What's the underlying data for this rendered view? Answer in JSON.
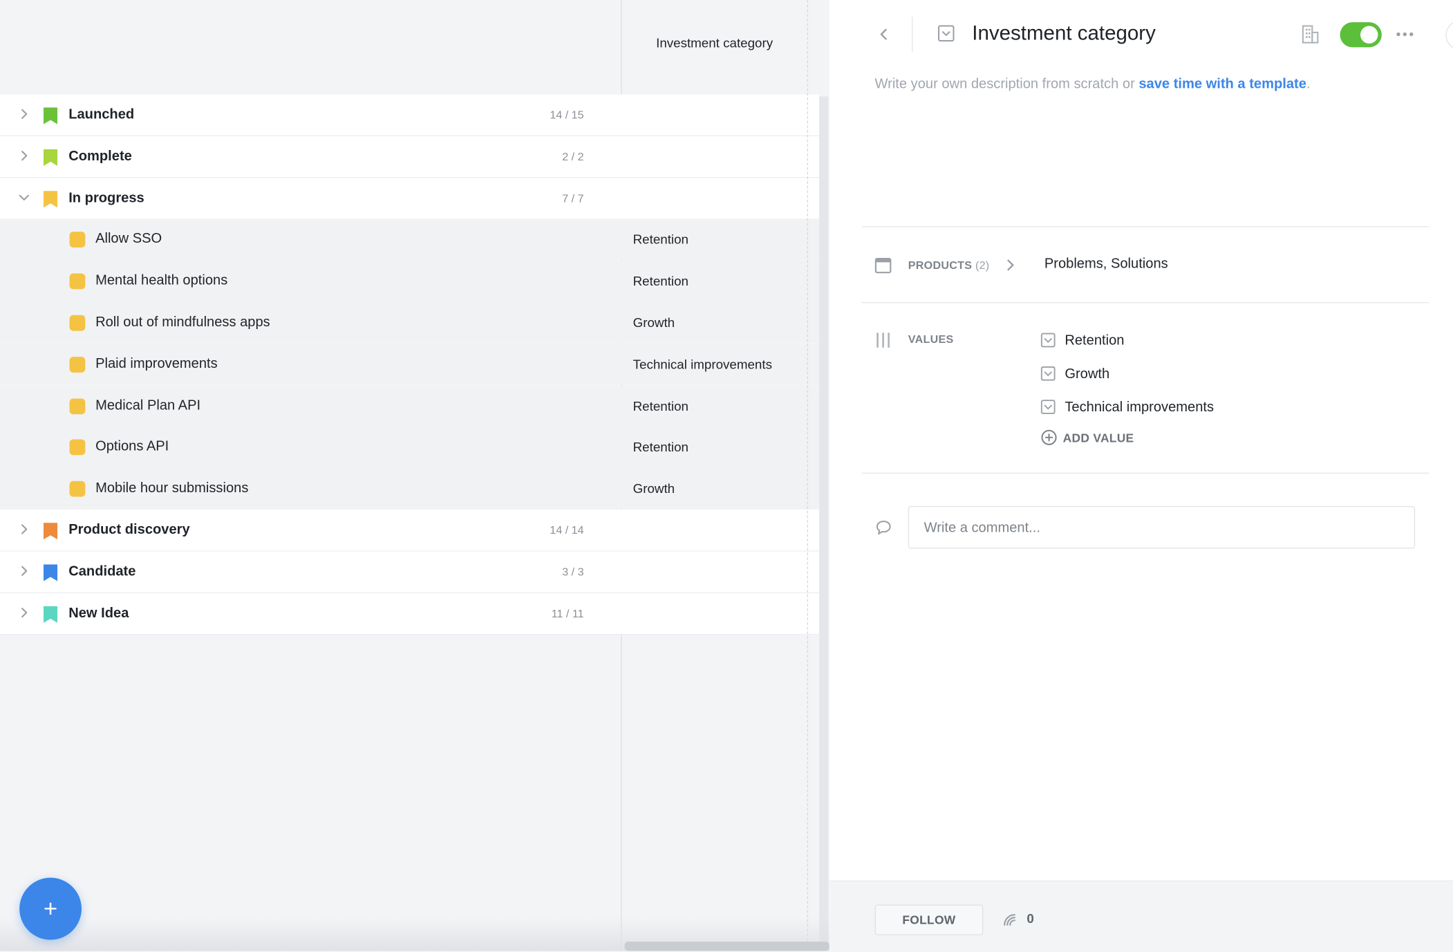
{
  "table": {
    "column_header": "Investment category",
    "rows": [
      {
        "label": "Launched",
        "count": "14 / 15",
        "color": "#6cc13b"
      },
      {
        "label": "Complete",
        "count": "2 / 2",
        "color": "#a8d63c"
      },
      {
        "label": "In progress",
        "count": "7 / 7",
        "color": "#f5c343",
        "expanded": true,
        "children": [
          {
            "label": "Allow SSO",
            "category": "Retention"
          },
          {
            "label": "Mental health options",
            "category": "Retention"
          },
          {
            "label": "Roll out of mindfulness apps",
            "category": "Growth"
          },
          {
            "label": "Plaid improvements",
            "category": "Technical improvements"
          },
          {
            "label": "Medical Plan API",
            "category": "Retention"
          },
          {
            "label": "Options API",
            "category": "Retention"
          },
          {
            "label": "Mobile hour submissions",
            "category": "Growth"
          }
        ]
      },
      {
        "label": "Product discovery",
        "count": "14 / 14",
        "color": "#ee8a3c"
      },
      {
        "label": "Candidate",
        "count": "3 / 3",
        "color": "#3b86e8"
      },
      {
        "label": "New Idea",
        "count": "11 / 11",
        "color": "#5bd6c0"
      }
    ]
  },
  "fab": {
    "label": "+",
    "color": "#3b86e8"
  },
  "detail": {
    "title": "Investment category",
    "toggle_on": true,
    "toggle_color": "#5bbf3a",
    "description_prompt": "Write your own description from scratch or ",
    "description_link": "save time with a template",
    "description_end": ".",
    "products": {
      "label": "PRODUCTS",
      "count": "(2)",
      "value": "Problems, Solutions"
    },
    "values": {
      "label": "VALUES",
      "items": [
        "Retention",
        "Growth",
        "Technical improvements"
      ],
      "add_label": "ADD VALUE"
    },
    "comment_placeholder": "Write a comment...",
    "follow_label": "FOLLOW",
    "follower_count": "0"
  },
  "accent_color": "#3b86e8"
}
